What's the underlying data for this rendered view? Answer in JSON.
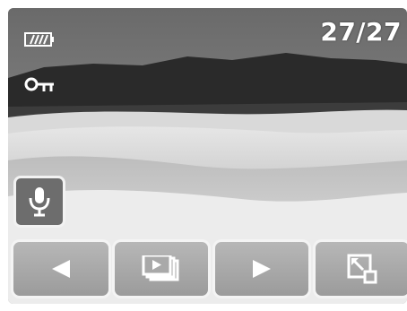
{
  "status": {
    "counter": "27/27",
    "battery_icon": "battery-icon",
    "protect_icon": "key-lock-icon"
  },
  "buttons": [
    {
      "name": "previous",
      "icon": "left-arrow-icon"
    },
    {
      "name": "slideshow",
      "icon": "slideshow-icon"
    },
    {
      "name": "next",
      "icon": "right-arrow-icon"
    },
    {
      "name": "resize",
      "icon": "resize-icon"
    }
  ],
  "voice_memo": {
    "icon": "microphone-icon"
  },
  "colors": {
    "button_face": "#a9a9a9",
    "button_border": "#f4f4f4",
    "icon_fill": "#ffffff",
    "mic_button_face": "#6d6d6d"
  }
}
